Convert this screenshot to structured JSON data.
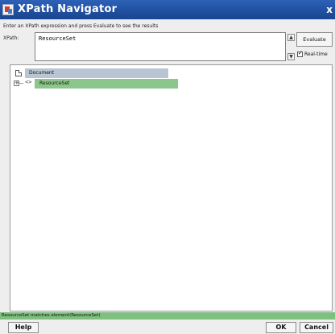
{
  "window": {
    "title": "XPath Navigator",
    "close_label": "x"
  },
  "instruction": "Enter an XPath expression and press Evaluate to see the results",
  "xpath": {
    "label": "XPath:",
    "value": "ResourceSet",
    "spin_up": "▲",
    "spin_down": "▼"
  },
  "evaluate_label": "Evaluate",
  "realtime": {
    "label": "Real-time",
    "checked": true
  },
  "tree": {
    "document_label": "Document",
    "expand_symbol": "+",
    "element_symbol": "<>",
    "resourceset_label": "ResourceSet",
    "colors": {
      "document_highlight": "#b8c6d3",
      "match_highlight": "#8cc68c"
    }
  },
  "status_text": "ResourceSet matches element(ResourceSet)",
  "buttons": {
    "help": "Help",
    "ok": "OK",
    "cancel": "Cancel"
  },
  "colors": {
    "titlebar": "#1f4f9e",
    "status_bar": "#7fbf7f"
  }
}
